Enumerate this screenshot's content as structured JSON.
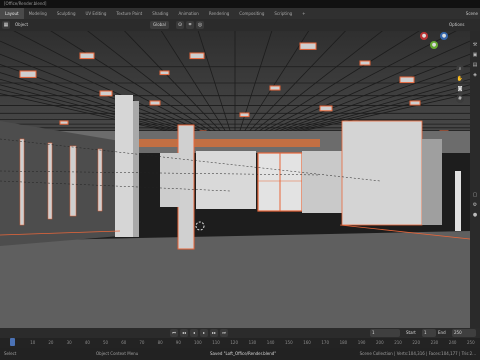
{
  "title_bar": {
    "text": "[Office/Render.blend]"
  },
  "tabs": [
    {
      "label": "Layout",
      "active": true
    },
    {
      "label": "Modeling"
    },
    {
      "label": "Sculpting"
    },
    {
      "label": "UV Editing"
    },
    {
      "label": "Texture Paint"
    },
    {
      "label": "Shading"
    },
    {
      "label": "Animation"
    },
    {
      "label": "Rendering"
    },
    {
      "label": "Compositing"
    },
    {
      "label": "Scripting"
    },
    {
      "label": "+"
    }
  ],
  "scene_label": "Scene",
  "viewport_header": {
    "mode": "Object",
    "transform_orientation": "Global",
    "options": "Options"
  },
  "timeline": {
    "current_frame": "1",
    "start_label": "Start",
    "start_value": "1",
    "end_label": "End",
    "end_value": "250"
  },
  "ruler_ticks": [
    "0",
    "10",
    "20",
    "30",
    "40",
    "50",
    "60",
    "70",
    "80",
    "90",
    "100",
    "110",
    "120",
    "130",
    "140",
    "150",
    "160",
    "170",
    "180",
    "190",
    "200",
    "210",
    "220",
    "230",
    "240",
    "250"
  ],
  "statusbar": {
    "left_action": "Select",
    "middle_action": "Object Context Menu",
    "message": "Saved \"Loft_Office/Render.blend\"",
    "stats": "Scene Collection | Verts:104,316 | Faces:104,177 | Tris:2..."
  },
  "colors": {
    "accent": "#4b72b5",
    "selection_outline": "#e8663a",
    "floor": "#5f5f5f",
    "ceiling": "#3f3f3f"
  },
  "icons": {
    "viewport_gizmos": [
      "x-axis-icon",
      "y-axis-icon",
      "z-axis-icon",
      "zoom-icon",
      "hand-pan-icon",
      "camera-icon",
      "grid-toggle-icon"
    ]
  }
}
